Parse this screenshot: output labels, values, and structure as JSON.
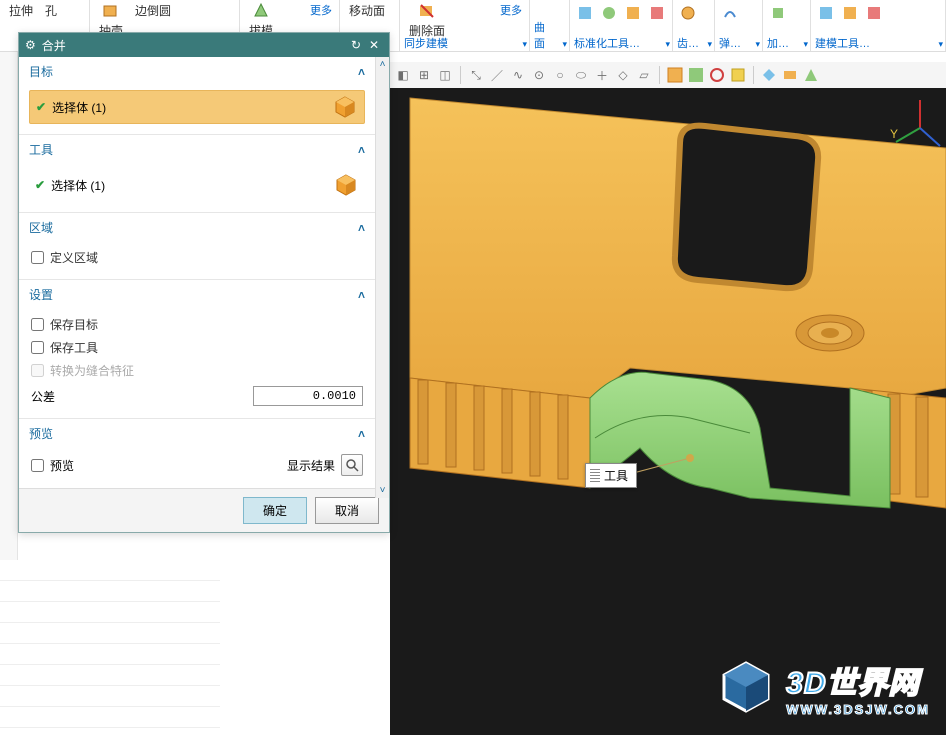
{
  "ribbon": {
    "items": [
      "拉伸",
      "孔",
      "抽壳",
      "边倒圆",
      "拔模",
      "移动面",
      "删除面"
    ],
    "more": "更多",
    "groups": [
      "同步建模",
      "标准化工具…",
      "齿…",
      "弹…",
      "加…",
      "建模工具…"
    ],
    "curve_label": "曲面"
  },
  "dialog": {
    "title": "合并",
    "sections": {
      "target": {
        "title": "目标",
        "row": "选择体 (1)"
      },
      "tool": {
        "title": "工具",
        "row": "选择体 (1)"
      },
      "region": {
        "title": "区域",
        "define": "定义区域"
      },
      "settings": {
        "title": "设置",
        "keep_target": "保存目标",
        "keep_tool": "保存工具",
        "convert": "转换为缝合特征",
        "tol_label": "公差",
        "tol_value": "0.0010"
      },
      "preview": {
        "title": "预览",
        "chk": "预览",
        "show": "显示结果"
      }
    },
    "ok": "确定",
    "cancel": "取消"
  },
  "viewport": {
    "callout": "工具"
  },
  "watermark": {
    "line1": "3D世界网",
    "line2": "WWW.3DSJW.COM"
  }
}
